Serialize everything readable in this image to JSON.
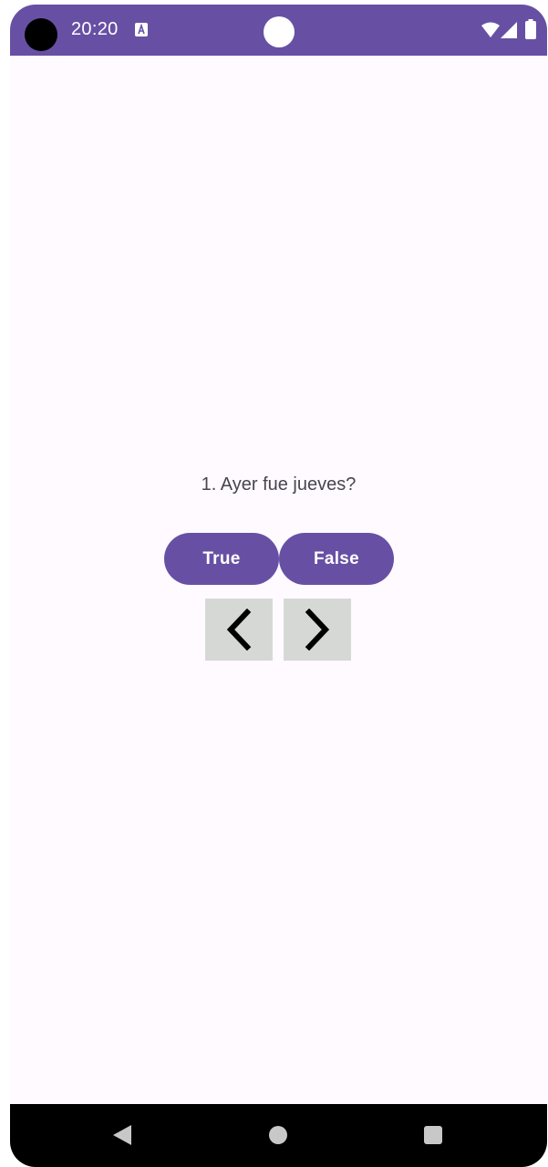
{
  "status_bar": {
    "time": "20:20",
    "icons": [
      "camera-cutout",
      "accessibility-notification-icon",
      "wifi-icon",
      "signal-icon",
      "battery-icon"
    ],
    "color": "#6750a4"
  },
  "quiz": {
    "question": "1. Ayer fue jueves?",
    "true_label": "True",
    "false_label": "False",
    "prev_icon": "chevron-left-icon",
    "next_icon": "chevron-right-icon"
  },
  "navigation_bar": {
    "icons": [
      "back-icon",
      "home-icon",
      "recents-icon"
    ]
  },
  "colors": {
    "accent": "#6750a4",
    "background": "#fefaff",
    "nav_button": "#d6d8d6",
    "text": "#49454f"
  }
}
